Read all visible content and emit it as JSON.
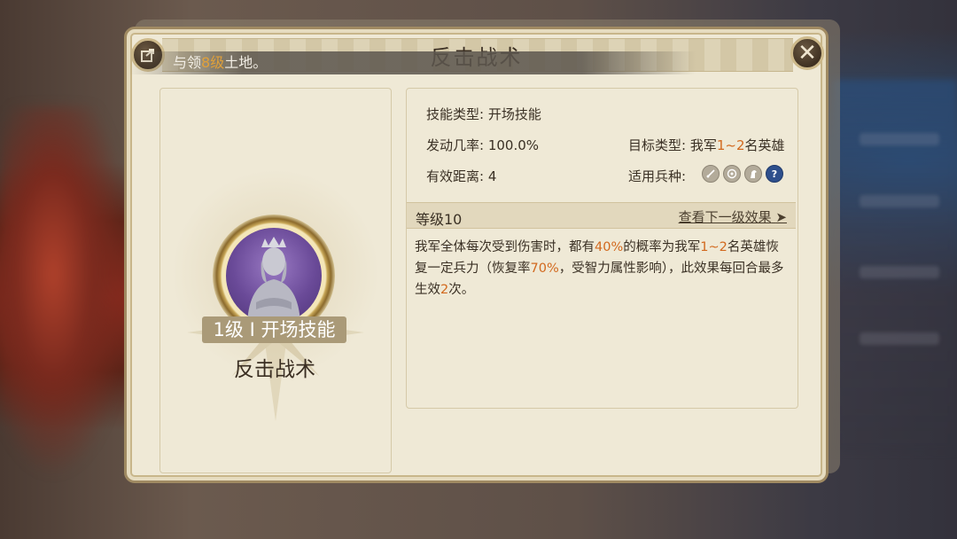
{
  "title": "反击战术",
  "banner": {
    "prefix": "与领",
    "highlight": "8级",
    "suffix": "土地。"
  },
  "skill": {
    "tag": "1级 I 开场技能",
    "name": "反击战术"
  },
  "attributes": {
    "skill_type_label": "技能类型:",
    "skill_type_value": "开场技能",
    "trigger_label": "发动几率:",
    "trigger_value": "100.0%",
    "range_label": "有效距离:",
    "range_value": "4",
    "target_label": "目标类型:",
    "target_prefix": "我军",
    "target_highlight": "1~2",
    "target_suffix": "名英雄",
    "units_label": "适用兵种:",
    "unit_icons": [
      "sword-icon",
      "bow-icon",
      "horse-icon",
      "question-icon"
    ],
    "question_glyph": "?"
  },
  "level": {
    "label": "等级10",
    "next_link": "查看下一级效果",
    "arrow": "➤"
  },
  "description": {
    "p1": "我军全体每次受到伤害时，都有",
    "h1": "40%",
    "p2": "的概率为我军",
    "h2": "1~2",
    "p3": "名英雄恢复一定兵力（恢复率",
    "h3": "70%",
    "p4": "，受智力属性影响），此效果每回合最多生效",
    "h4": "2",
    "p5": "次。"
  },
  "buttons": {
    "close_glyph": "✕"
  },
  "colors": {
    "highlight": "#d2691e",
    "panel": "#efe9d6",
    "accent": "#a08a62"
  }
}
